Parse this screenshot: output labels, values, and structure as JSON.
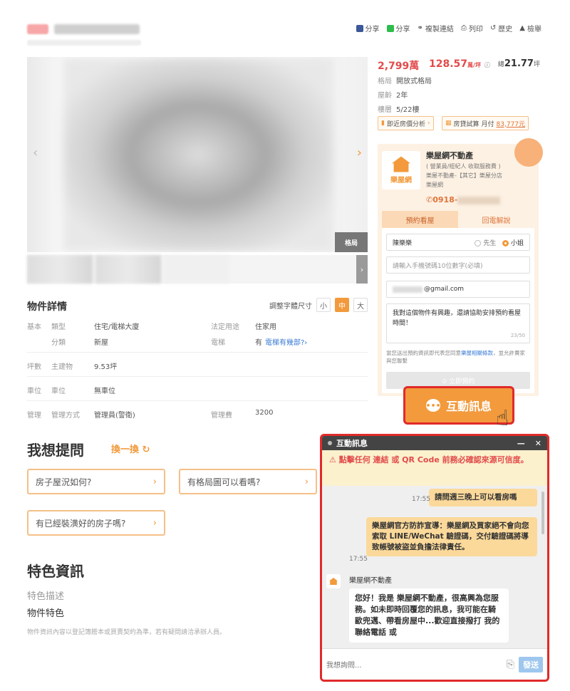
{
  "header": {
    "actions": [
      {
        "label": "分享",
        "icon": "facebook-icon",
        "color": "#3b5998"
      },
      {
        "label": "分享",
        "icon": "line-icon",
        "color": "#2ebd4b"
      },
      {
        "label": "複製連結",
        "icon": "link-icon"
      },
      {
        "label": "列印",
        "icon": "print-icon"
      },
      {
        "label": "歷史",
        "icon": "history-icon"
      },
      {
        "label": "檢舉",
        "icon": "warning-icon"
      }
    ]
  },
  "gallery": {
    "badge": "格局",
    "next": "›"
  },
  "summary": {
    "price": "2,799萬",
    "unit_price": "128.57",
    "unit_suffix": "萬/坪",
    "area_prefix": "總",
    "area": "21.77",
    "area_unit": "坪",
    "specs": [
      {
        "label": "格局",
        "value": "開放式格局"
      },
      {
        "label": "屋齡",
        "value": "2年"
      },
      {
        "label": "樓層",
        "value": "5/22樓"
      }
    ],
    "price_analysis": "即近房價分析",
    "loan_calc": "房貸試算",
    "monthly_label": "月付",
    "monthly_value": "83,777元"
  },
  "agent": {
    "logo_text": "樂屋網",
    "name": "樂屋網不動產",
    "role": "( 營業員/經紀人 收取服務費 )",
    "company": "樂屋不動產-【其它】樂屋分店",
    "brand": "樂屋網",
    "phone_prefix": "0918-"
  },
  "form": {
    "tabs": [
      "預約看屋",
      "回電解說"
    ],
    "name_value": "陳樂樂",
    "gender_options": [
      "先生",
      "小姐"
    ],
    "phone_placeholder": "請輸入手機號碼10位數字(必填)",
    "email_suffix": "@gmail.com",
    "message": "我對這個物件有興趣，還請協助安排預約看屋時間！",
    "char_count": "23/50",
    "consent_prefix": "當您送出預約資訊即代表您同意",
    "consent_link": "樂屋相關條款",
    "consent_suffix": "，並允許賣家與您聯繫",
    "submit_label": "⊙ 立即預約"
  },
  "chat_trigger": {
    "label": "互動訊息"
  },
  "details": {
    "title": "物件詳情",
    "font_size_label": "調整字體尺寸",
    "font_sizes": [
      "小",
      "中",
      "大"
    ],
    "rows": {
      "basic": "基本",
      "type_label": "類型",
      "type_value": "住宅/電梯大廈",
      "use_label": "法定用途",
      "use_value": "住家用",
      "category_label": "分類",
      "category_value": "新屋",
      "elevator_label": "電梯",
      "elevator_value": "有",
      "elevator_link": "電梯有幾部?›",
      "area_group": "坪數",
      "main_label": "主建物",
      "main_value": "9.53坪",
      "parking_group": "車位",
      "parking_label": "車位",
      "parking_value": "無車位",
      "mgmt_group": "管理",
      "mgmt_label": "管理方式",
      "mgmt_value": "管理員(警衛)",
      "fee_label": "管理費",
      "fee_value": "3200"
    }
  },
  "questions": {
    "title": "我想提問",
    "swap": "換一換 ↻",
    "items": [
      "房子屋況如何?",
      "有格局圖可以看嗎?",
      "有已經裝潢好的房子嗎?"
    ]
  },
  "features": {
    "title": "特色資訊",
    "desc": "特色描述",
    "feature": "物件特色",
    "disclaimer": "物件資訊內容以登記簿謄本或買賣契約為準，若有疑問請洽承辦人員。"
  },
  "chat": {
    "title": "互動訊息",
    "minimize": "—",
    "close": "✕",
    "warning": "⚠ 點擊任何 連結 或 QR Code 前務必確認來源可信度。",
    "messages": [
      {
        "time": "17:55",
        "text": "請問週三晚上可以看房嗎"
      },
      {
        "time": "17:55",
        "text": "樂屋網官方防詐宣導：樂屋網及買家絕不會向您索取 LINE/WeChat 驗證碼，交付驗證碼將導致帳號被盜並負擔法律責任。"
      }
    ],
    "sender": "樂屋網不動產",
    "reply": "您好！我是 樂屋網不動產，很高興為您服務。如未即時回覆您的訊息，我可能在騎歐兜邁、帶看房屋中...歡迎直接撥打 我的聯絡電話 或",
    "input_placeholder": "我想詢問...",
    "send_label": "發送"
  },
  "colors": {
    "accent": "#f29a3c",
    "price": "#e24b4b",
    "highlight": "#e02a2a"
  }
}
